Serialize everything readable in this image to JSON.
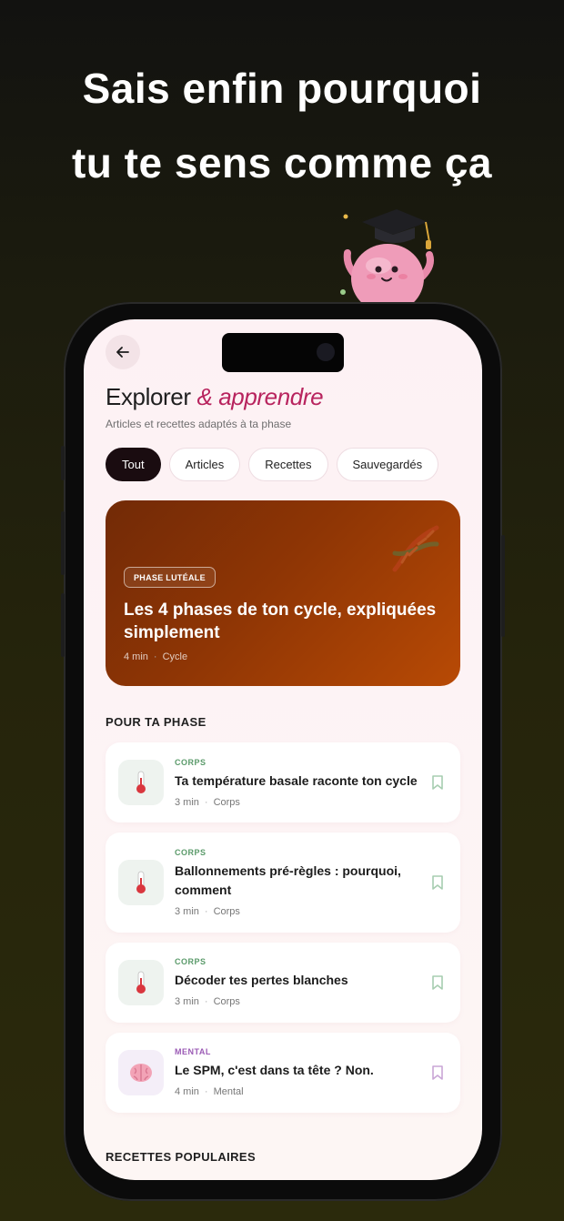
{
  "headline": {
    "line1": "Sais enfin pourquoi",
    "line2": "tu te sens comme ça"
  },
  "header": {
    "title": "Explorer",
    "title_accent": "& apprendre",
    "subtitle": "Articles et recettes adaptés à ta phase"
  },
  "filters": {
    "items": [
      {
        "label": "Tout"
      },
      {
        "label": "Articles"
      },
      {
        "label": "Recettes"
      },
      {
        "label": "Sauvegardés"
      }
    ],
    "selected": "Tout"
  },
  "featured": {
    "badge": "PHASE LUTÉALE",
    "title": "Les 4 phases de ton cycle, expliquées simplement",
    "duration": "4 min",
    "category": "Cycle"
  },
  "sections": {
    "for_phase": "POUR TA PHASE",
    "popular_recipes": "RECETTES POPULAIRES"
  },
  "articles": [
    {
      "category": "CORPS",
      "title": "Ta température basale raconte ton cycle",
      "duration": "3 min",
      "tag": "Corps",
      "icon": "thermometer-icon"
    },
    {
      "category": "CORPS",
      "title": "Ballonnements pré-règles : pourquoi, comment",
      "duration": "3 min",
      "tag": "Corps",
      "icon": "thermometer-icon"
    },
    {
      "category": "CORPS",
      "title": "Décoder tes pertes blanches",
      "duration": "3 min",
      "tag": "Corps",
      "icon": "thermometer-icon"
    },
    {
      "category": "MENTAL",
      "title": "Le SPM, c'est dans ta tête ? Non.",
      "duration": "4 min",
      "tag": "Mental",
      "icon": "brain-icon"
    }
  ],
  "colors": {
    "accent": "#b8245e",
    "corps": "#5a9a6a",
    "mental": "#9b5bb5",
    "hero": "#8e3505"
  }
}
